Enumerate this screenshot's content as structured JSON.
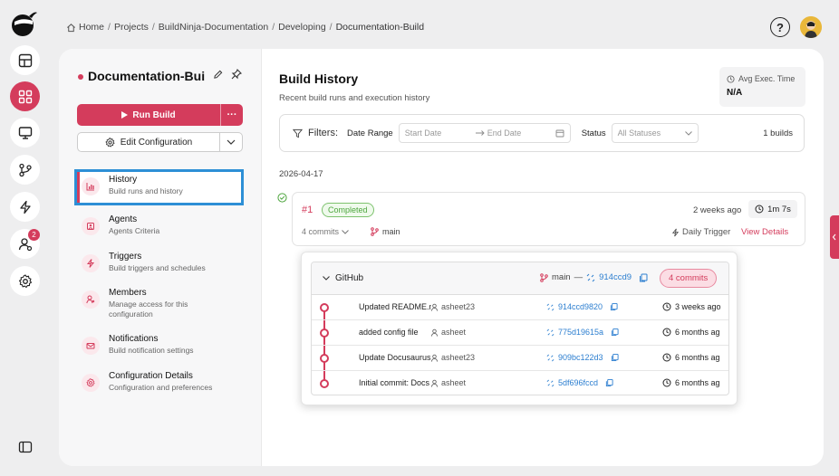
{
  "breadcrumb": {
    "items": [
      "Home",
      "Projects",
      "BuildNinja-Documentation",
      "Developing",
      "Documentation-Build"
    ]
  },
  "rail": {
    "badge_count": "2"
  },
  "project": {
    "title": "Documentation-Build",
    "run_label": "Run Build",
    "more_label": "···",
    "edit_config_label": "Edit Configuration"
  },
  "nav": [
    {
      "title": "History",
      "subtitle": "Build runs and history",
      "icon": "chart-icon"
    },
    {
      "title": "Agents",
      "subtitle": "Agents Criteria",
      "icon": "agent-icon"
    },
    {
      "title": "Triggers",
      "subtitle": "Build triggers and schedules",
      "icon": "bolt-icon"
    },
    {
      "title": "Members",
      "subtitle": "Manage access for this configuration",
      "icon": "members-icon"
    },
    {
      "title": "Notifications",
      "subtitle": "Build notification settings",
      "icon": "mail-icon"
    },
    {
      "title": "Configuration Details",
      "subtitle": "Configuration and preferences",
      "icon": "gear-icon"
    }
  ],
  "history": {
    "title": "Build History",
    "subtitle": "Recent build runs and execution history",
    "avg_label": "Avg Exec. Time",
    "avg_value": "N/A"
  },
  "filters": {
    "label": "Filters:",
    "date_range_label": "Date Range",
    "start_placeholder": "Start Date",
    "end_placeholder": "End Date",
    "status_label": "Status",
    "status_value": "All Statuses",
    "count": "1 builds"
  },
  "date_group": "2026-04-17",
  "build": {
    "number": "#1",
    "status": "Completed",
    "ago": "2 weeks ago",
    "duration": "1m 7s",
    "commits_label": "4 commits",
    "branch": "main",
    "trigger": "Daily Trigger",
    "view_details": "View Details"
  },
  "commits_popup": {
    "provider": "GitHub",
    "branch": "main",
    "dash": "—",
    "head_sha": "914ccd9",
    "count_label": "4 commits",
    "commits": [
      {
        "message": "Updated README.md",
        "author": "asheet23",
        "sha": "914ccd9820",
        "when": "3 weeks ago"
      },
      {
        "message": "added config file",
        "author": "asheet",
        "sha": "775d19615a",
        "when": "6 months ag"
      },
      {
        "message": "Update Docusaurus",
        "author": "asheet23",
        "sha": "909bc122d3",
        "when": "6 months ag"
      },
      {
        "message": "Initial commit: Docs",
        "author": "asheet",
        "sha": "5df696fccd",
        "when": "6 months ag"
      }
    ]
  },
  "colors": {
    "accent": "#d43c5c",
    "link": "#2d7fd0",
    "success": "#4ea63f",
    "focus": "#2d8fd6"
  }
}
